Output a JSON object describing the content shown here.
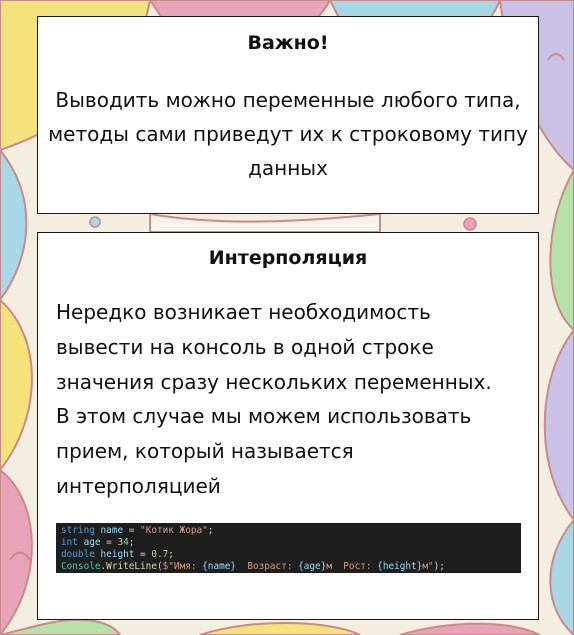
{
  "card_important": {
    "title": "Важно!",
    "body": "Выводить можно переменные любого типа, методы сами приведут их к строковому типу данных"
  },
  "card_interpolation": {
    "title": "Интерполяция",
    "body": "Нередко возникает необходимость\nвывести на консоль в одной строке\nзначения сразу нескольких переменных.\nВ этом случае мы можем использовать\nприем, который называется\nинтерполяцией"
  },
  "code": {
    "line1": {
      "type": "string",
      "var": "name",
      "op": " = ",
      "value": "\"Котик Жора\"",
      "end": ";"
    },
    "line2": {
      "type": "int",
      "var": "age",
      "op": " = ",
      "value": "34",
      "end": ";"
    },
    "line3": {
      "type": "double",
      "var": "height",
      "op": " = ",
      "value": "0.7",
      "end": ";"
    },
    "line4": {
      "class": "Console",
      "dot": ".",
      "method": "WriteLine",
      "open": "(",
      "s1": "$\"Имя: ",
      "e1": "{name}",
      "s2": "  Возраст: ",
      "e2": "{age}",
      "s3": "м  Рост: ",
      "e3": "{height}",
      "s4": "м\"",
      "close": ");"
    }
  },
  "colors": {
    "code_background": "#1e1e1e",
    "keyword": "#569cd6",
    "identifier": "#9cdcfe",
    "string": "#d69d85",
    "number": "#b5cea8",
    "class": "#4ec9b0",
    "method": "#dcdcaa"
  }
}
